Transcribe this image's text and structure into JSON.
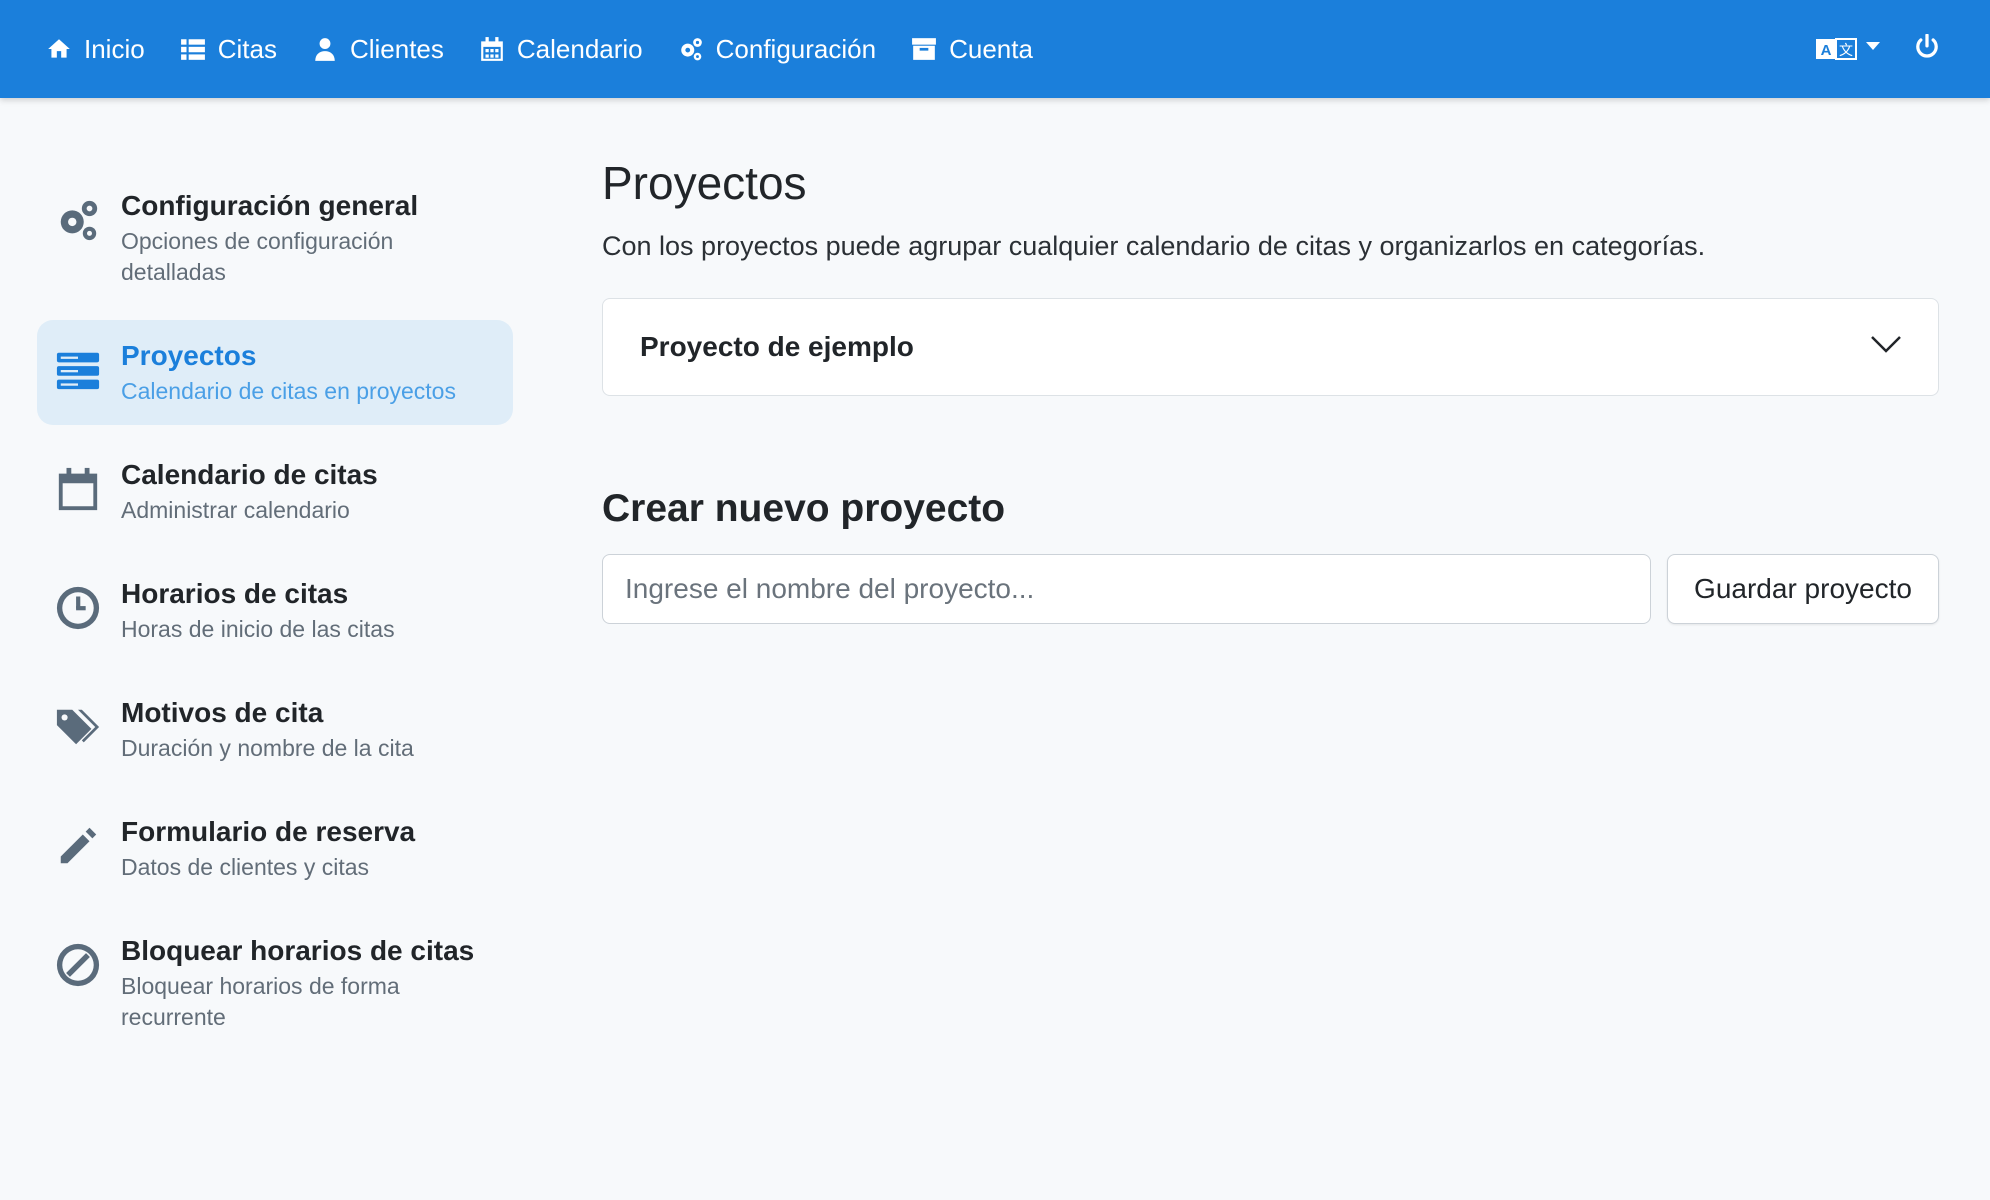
{
  "nav": {
    "items": [
      {
        "label": "Inicio",
        "icon": "home-icon"
      },
      {
        "label": "Citas",
        "icon": "list-icon"
      },
      {
        "label": "Clientes",
        "icon": "user-icon"
      },
      {
        "label": "Calendario",
        "icon": "calendar-icon"
      },
      {
        "label": "Configuración",
        "icon": "cogs-icon"
      },
      {
        "label": "Cuenta",
        "icon": "archive-icon"
      }
    ],
    "language_icon": "translate-icon",
    "power_icon": "power-icon"
  },
  "sidebar": {
    "items": [
      {
        "title": "Configuración general",
        "subtitle": "Opciones de configuración detalladas",
        "icon": "cogs-icon"
      },
      {
        "title": "Proyectos",
        "subtitle": "Calendario de citas en proyectos",
        "icon": "server-icon",
        "active": true
      },
      {
        "title": "Calendario de citas",
        "subtitle": "Administrar calendario",
        "icon": "calendar-icon"
      },
      {
        "title": "Horarios de citas",
        "subtitle": "Horas de inicio de las citas",
        "icon": "clock-icon"
      },
      {
        "title": "Motivos de cita",
        "subtitle": "Duración y nombre de la cita",
        "icon": "tags-icon"
      },
      {
        "title": "Formulario de reserva",
        "subtitle": "Datos de clientes y citas",
        "icon": "pencil-icon"
      },
      {
        "title": "Bloquear horarios de citas",
        "subtitle": "Bloquear horarios de forma recurrente",
        "icon": "ban-icon"
      }
    ]
  },
  "main": {
    "title": "Proyectos",
    "description": "Con los proyectos puede agrupar cualquier calendario de citas y organizarlos en categorías.",
    "projects": [
      {
        "name": "Proyecto de ejemplo"
      }
    ],
    "create": {
      "title": "Crear nuevo proyecto",
      "placeholder": "Ingrese el nombre del proyecto...",
      "save_label": "Guardar proyecto"
    }
  },
  "colors": {
    "navbar": "#1b7fdb",
    "active_bg": "#dfedf8",
    "page_bg": "#f7f9fb"
  }
}
